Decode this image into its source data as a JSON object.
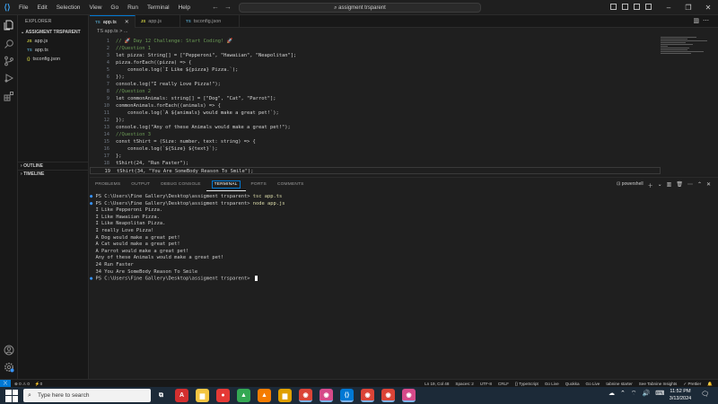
{
  "titlebar": {
    "menu": [
      "File",
      "Edit",
      "Selection",
      "View",
      "Go",
      "Run",
      "Terminal",
      "Help"
    ],
    "search": "assigment trsparent"
  },
  "activity_bar": {
    "items": [
      "explorer-icon",
      "search-icon",
      "source-control-icon",
      "run-debug-icon",
      "extensions-icon"
    ],
    "bottom": [
      "account-icon",
      "manage-gear-icon"
    ]
  },
  "sidebar": {
    "header": "EXPLORER",
    "folder": "ASSIGMENT TRSPARENT",
    "files": [
      {
        "icon": "JS",
        "name": "app.js",
        "color": "#cbcb41"
      },
      {
        "icon": "TS",
        "name": "app.ts",
        "color": "#519aba"
      },
      {
        "icon": "{}",
        "name": "tsconfig.json",
        "color": "#cbcb41"
      }
    ],
    "outline": "OUTLINE",
    "timeline": "TIMELINE"
  },
  "tabs": [
    {
      "icon": "TS",
      "label": "app.ts",
      "active": true
    },
    {
      "icon": "JS",
      "label": "app.js",
      "active": false
    },
    {
      "icon": "TS",
      "label": "tsconfig.json",
      "active": false
    }
  ],
  "breadcrumb": "TS app.ts > ...",
  "editor": {
    "lines": [
      {
        "n": "1",
        "t": "// 🚀 Day 12 Challenge: Start Coding! 🚀"
      },
      {
        "n": "2",
        "t": "//Question 1"
      },
      {
        "n": "3",
        "t": "let pizza: String[] = [\"Pepperoni\", \"Hawaiian\", \"Neapolitan\"];"
      },
      {
        "n": "4",
        "t": "pizza.forEach((pizza) => {"
      },
      {
        "n": "5",
        "t": "    console.log(`I Like ${pizza} Pizza.`);"
      },
      {
        "n": "6",
        "t": "});"
      },
      {
        "n": "7",
        "t": "console.log(\"I really Love Pizza!\");"
      },
      {
        "n": "8",
        "t": "//Question 2"
      },
      {
        "n": "9",
        "t": "let commonAnimals: string[] = [\"Dog\", \"Cat\", \"Parrot\"];"
      },
      {
        "n": "10",
        "t": "commonAnimals.forEach((animals) => {"
      },
      {
        "n": "11",
        "t": "    console.log(`A ${animals} would make a great pet!`);"
      },
      {
        "n": "12",
        "t": "});"
      },
      {
        "n": "13",
        "t": "console.log(\"Any of these Animals would make a great pet!\");"
      },
      {
        "n": "14",
        "t": "//Question 3"
      },
      {
        "n": "15",
        "t": "const tShirt = (Size: number, text: string) => {"
      },
      {
        "n": "16",
        "t": "    console.log(`${Size} ${text}`);"
      },
      {
        "n": "17",
        "t": "};"
      },
      {
        "n": "18",
        "t": "tShirt(24, \"Run Faster\");"
      },
      {
        "n": "19",
        "t": "tShirt(34, \"You Are SomeBody Reason To Smile\");"
      }
    ]
  },
  "panel": {
    "tabs": [
      "PROBLEMS",
      "OUTPUT",
      "DEBUG CONSOLE",
      "TERMINAL",
      "PORTS",
      "COMMENTS"
    ],
    "active_tab": "TERMINAL",
    "shell": "powershell",
    "terminal_lines": [
      {
        "kind": "prompt",
        "prompt": "PS C:\\Users\\Fine Gallery\\Desktop\\assigment trsparent> ",
        "cmd": "tsc app.ts"
      },
      {
        "kind": "prompt",
        "prompt": "PS C:\\Users\\Fine Gallery\\Desktop\\assigment trsparent> ",
        "cmd": "node app.js"
      },
      {
        "kind": "out",
        "text": "I Like Pepperoni Pizza."
      },
      {
        "kind": "out",
        "text": "I Like Hawaiian Pizza."
      },
      {
        "kind": "out",
        "text": "I Like Neapolitan Pizza."
      },
      {
        "kind": "out",
        "text": "I really Love Pizza!"
      },
      {
        "kind": "out",
        "text": "A Dog would make a great pet!"
      },
      {
        "kind": "out",
        "text": "A Cat would make a great pet!"
      },
      {
        "kind": "out",
        "text": "A Parrot would make a great pet!"
      },
      {
        "kind": "out",
        "text": "Any of these Animals would make a great pet!"
      },
      {
        "kind": "out",
        "text": "24 Run Faster"
      },
      {
        "kind": "out",
        "text": "34 You Are SomeBody Reason To Smile"
      },
      {
        "kind": "prompt",
        "prompt": "PS C:\\Users\\Fine Gallery\\Desktop\\assigment trsparent> ",
        "cmd": ""
      }
    ]
  },
  "statusbar": {
    "left": [
      "⊗ 0 ⚠ 0",
      "⚡0"
    ],
    "right": [
      "Ln 19, Col 48",
      "Spaces: 2",
      "UTF-8",
      "CRLF",
      "{} TypeScript",
      "Go Live",
      "Quokka",
      "Go Live",
      "tabnine starter",
      "See Tabnine Insights",
      "✓ Prettier"
    ]
  },
  "taskbar": {
    "search_placeholder": "Type here to search",
    "apps": [
      {
        "name": "task-view-icon",
        "glyph": "⧉",
        "color": "#1c2a38"
      },
      {
        "name": "pdf-app-icon",
        "glyph": "A",
        "color": "#d32f2f"
      },
      {
        "name": "file-explorer-icon",
        "glyph": "▆",
        "color": "#f4c542"
      },
      {
        "name": "screen-recorder-icon",
        "glyph": "●",
        "color": "#e53935"
      },
      {
        "name": "google-drive-icon",
        "glyph": "▲",
        "color": "#34a853"
      },
      {
        "name": "vlc-icon",
        "glyph": "▲",
        "color": "#f57c00"
      },
      {
        "name": "folder-icon",
        "glyph": "▆",
        "color": "#e0a000"
      },
      {
        "name": "chrome-icon",
        "glyph": "◉",
        "color": "#db4437"
      },
      {
        "name": "chrome-profile-icon",
        "glyph": "◉",
        "color": "#d64a8a"
      },
      {
        "name": "vscode-icon",
        "glyph": "⟨⟩",
        "color": "#0078d4"
      },
      {
        "name": "chrome-icon-2",
        "glyph": "◉",
        "color": "#db4437"
      },
      {
        "name": "chrome-icon-3",
        "glyph": "◉",
        "color": "#db4437"
      },
      {
        "name": "chrome-icon-4",
        "glyph": "◉",
        "color": "#d64a8a"
      }
    ],
    "time": "11:52 PM",
    "date": "3/13/2024"
  }
}
